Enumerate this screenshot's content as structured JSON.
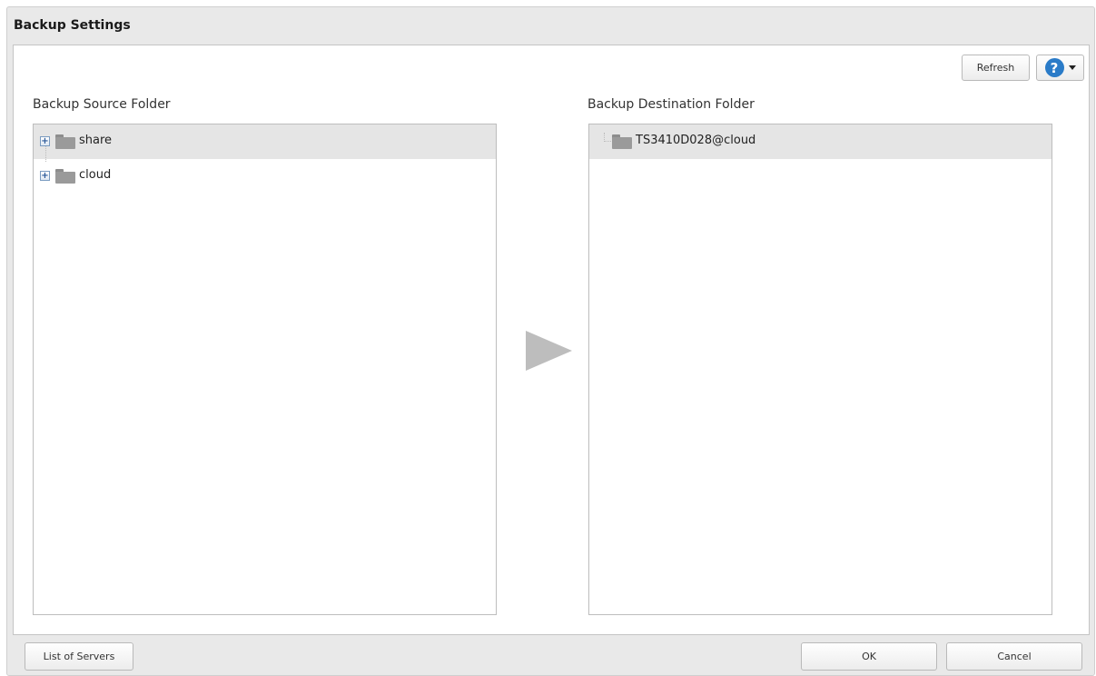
{
  "dialog": {
    "title": "Backup Settings"
  },
  "toolbar": {
    "refresh_label": "Refresh",
    "help_icon": "help-icon",
    "help_glyph": "?"
  },
  "source": {
    "label": "Backup Source Folder",
    "items": [
      {
        "name": "share",
        "selected": true,
        "expander": "+"
      },
      {
        "name": "cloud",
        "selected": false,
        "expander": "+"
      }
    ]
  },
  "destination": {
    "label": "Backup Destination Folder",
    "items": [
      {
        "name": "TS3410D028@cloud",
        "selected": true
      }
    ]
  },
  "footer": {
    "list_label": "List of Servers",
    "ok_label": "OK",
    "cancel_label": "Cancel"
  },
  "colors": {
    "selection": "#e5e5e5",
    "help_blue": "#2a7bc8",
    "arrow": "#bdbdbd"
  }
}
